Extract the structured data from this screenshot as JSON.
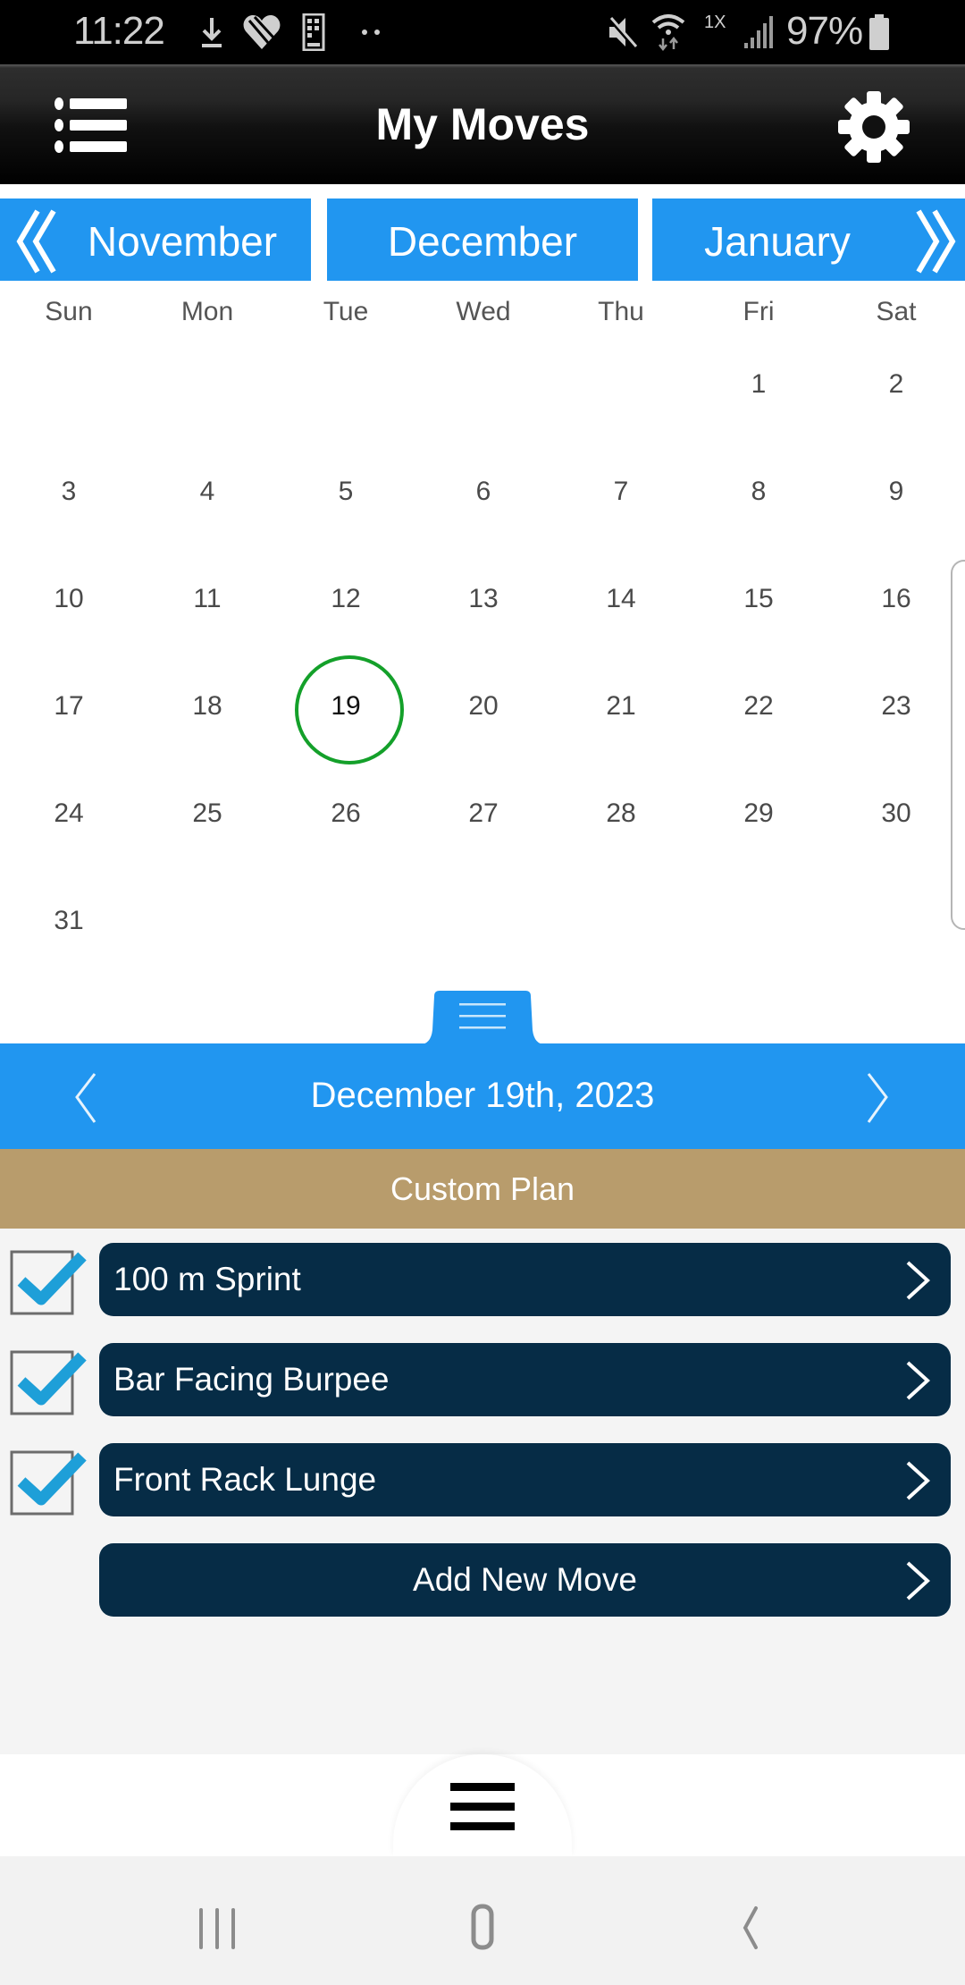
{
  "status_bar": {
    "time": "11:22",
    "battery_percent": "97%",
    "network_label": "1X",
    "left_icons": [
      "download-icon",
      "heart-shield-icon",
      "device-grid-icon",
      "more-dots-icon"
    ],
    "right_icons": [
      "mute-icon",
      "wifi-icon",
      "signal-icon",
      "battery-icon"
    ]
  },
  "header": {
    "title": "My Moves",
    "menu_icon": "list-icon",
    "settings_icon": "gear-icon"
  },
  "month_nav": {
    "previous": "November",
    "current": "December",
    "next": "January"
  },
  "calendar": {
    "weekdays": [
      "Sun",
      "Mon",
      "Tue",
      "Wed",
      "Thu",
      "Fri",
      "Sat"
    ],
    "weeks": [
      [
        "",
        "",
        "",
        "",
        "",
        "1",
        "2"
      ],
      [
        "3",
        "4",
        "5",
        "6",
        "7",
        "8",
        "9"
      ],
      [
        "10",
        "11",
        "12",
        "13",
        "14",
        "15",
        "16"
      ],
      [
        "17",
        "18",
        "19",
        "20",
        "21",
        "22",
        "23"
      ],
      [
        "24",
        "25",
        "26",
        "27",
        "28",
        "29",
        "30"
      ],
      [
        "31",
        "",
        "",
        "",
        "",
        "",
        ""
      ]
    ],
    "selected_day": "19",
    "selected_color": "#14a02a"
  },
  "date_bar": {
    "label": "December 19th, 2023"
  },
  "plan": {
    "label": "Custom Plan"
  },
  "moves": [
    {
      "name": "100 m Sprint",
      "checked": true
    },
    {
      "name": "Bar Facing Burpee",
      "checked": true
    },
    {
      "name": "Front Rack Lunge",
      "checked": true
    }
  ],
  "add_move_label": "Add New Move",
  "colors": {
    "accent_blue": "#2196f0",
    "navy": "#062c46",
    "plan_tan": "#b89c6c",
    "check_blue": "#1e9fd8"
  }
}
